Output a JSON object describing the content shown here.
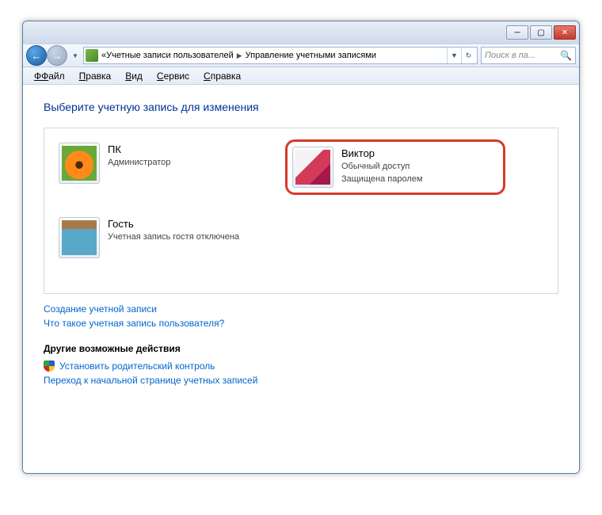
{
  "breadcrumb": {
    "prefix": "«",
    "seg1": "Учетные записи пользователей",
    "seg2": "Управление учетными записями"
  },
  "search": {
    "placeholder": "Поиск в па..."
  },
  "menu": {
    "file": "Файл",
    "edit": "Правка",
    "view": "Вид",
    "tools": "Сервис",
    "help": "Справка"
  },
  "heading": "Выберите учетную запись для изменения",
  "accounts": [
    {
      "name": "ПК",
      "line1": "Администратор",
      "line2": ""
    },
    {
      "name": "Виктор",
      "line1": "Обычный доступ",
      "line2": "Защищена паролем"
    },
    {
      "name": "Гость",
      "line1": "Учетная запись гостя отключена",
      "line2": ""
    }
  ],
  "links": {
    "create": "Создание учетной записи",
    "what": "Что такое учетная запись пользователя?"
  },
  "other": {
    "title": "Другие возможные действия",
    "parental": "Установить родительский контроль",
    "home": "Переход к начальной странице учетных записей"
  }
}
